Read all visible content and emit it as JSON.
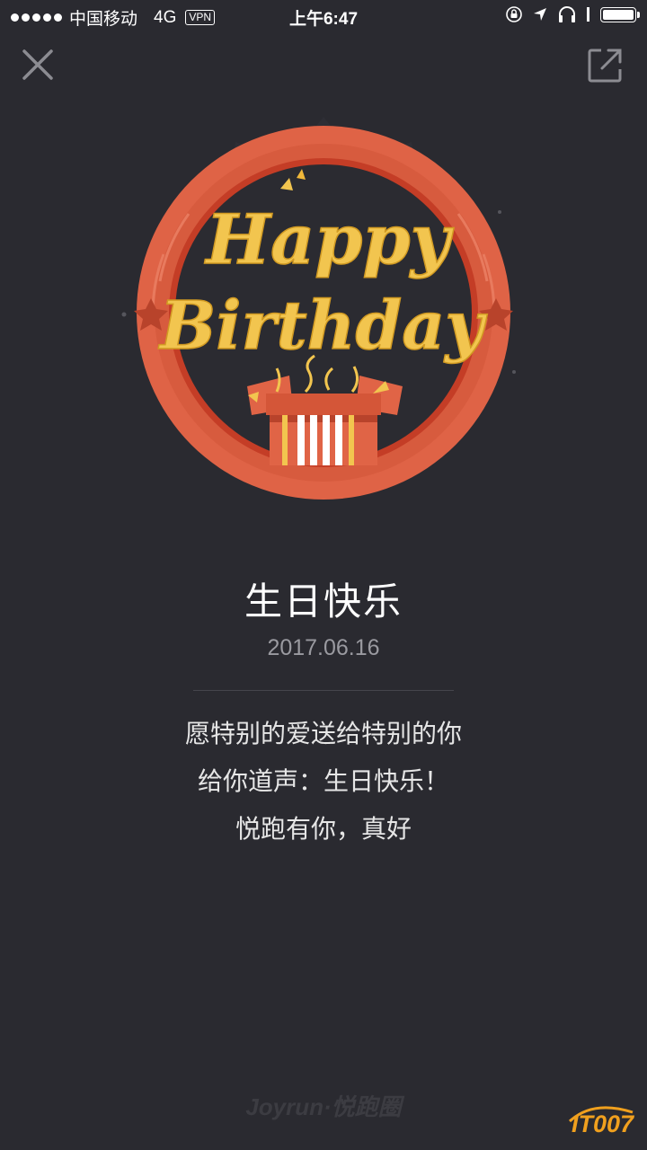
{
  "status_bar": {
    "carrier": "中国移动",
    "network": "4G",
    "vpn": "VPN",
    "time": "上午6:47"
  },
  "badge": {
    "line1": "Happy",
    "line2": "Birthday"
  },
  "content": {
    "title": "生日快乐",
    "date": "2017.06.16",
    "message_lines": [
      "愿特别的爱送给特别的你",
      "给你道声：生日快乐！",
      "悦跑有你，真好"
    ]
  },
  "footer": {
    "brand": "Joyrun·悦跑圈",
    "watermark": "IT007"
  },
  "colors": {
    "background": "#2a2a30",
    "ring": "#e06446",
    "ring_dark": "#c7482e",
    "gold": "#f2c54f",
    "date_gray": "#9a9aa0"
  },
  "icons": [
    "close-icon",
    "share-icon",
    "gift-box-icon"
  ]
}
